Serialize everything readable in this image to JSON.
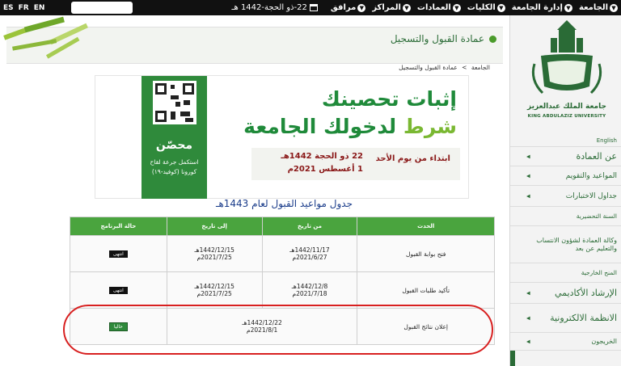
{
  "topbar": {
    "nav": [
      {
        "label": "الجامعة"
      },
      {
        "label": "إدارة الجامعة"
      },
      {
        "label": "الكليات"
      },
      {
        "label": "العمادات"
      },
      {
        "label": "المراكز"
      },
      {
        "label": "مرافق"
      }
    ],
    "date": "22-ذو الحجة-1442 هـ",
    "langs": [
      "ES",
      "FR",
      "EN"
    ]
  },
  "header": {
    "title": "عمادة القبول والتسجيل",
    "breadcrumb_home": "الجامعة",
    "breadcrumb_sep": ">",
    "breadcrumb_current": "عمادة القبول والتسجيل"
  },
  "logo": {
    "name_ar": "جامعة الملك عبدالعزيز",
    "name_en": "KING ABDULAZIZ UNIVERSITY"
  },
  "sidebar": {
    "items": [
      {
        "label": "English"
      },
      {
        "label": "عن العمادة"
      },
      {
        "label": "المواعيد والتقويم"
      },
      {
        "label": "جداول الاختبارات"
      },
      {
        "label": "السنة التحضيرية"
      },
      {
        "label": "وكالة العمادة لشؤون الانتساب والتعليم عن بعد"
      },
      {
        "label": "المنح الخارجية"
      },
      {
        "label": "الإرشاد الأكاديمي"
      },
      {
        "label": "الانظمة الالكترونية"
      },
      {
        "label": "الخريجون"
      }
    ]
  },
  "banner": {
    "line1": "إثبات تحصينك",
    "line2_w1": "شرط",
    "line2_w2": "لدخولك الجامعة",
    "start": "ابتداء من يوم الأحد",
    "date_h": "22 ذو الحجة 1442هـ",
    "date_g": "1 أغسطس 2021م",
    "qr_word": "محصّن",
    "qr_sub1": "استكمل جرعة لقاح",
    "qr_sub2": "كورونا (كوفيد-١٩)"
  },
  "table": {
    "title": "جدول مواعيد القبول لعام 1443هـ",
    "headers": [
      "الحدث",
      "من تاريخ",
      "إلى تاريخ",
      "حالة البرنامج"
    ],
    "rows": [
      {
        "event": "فتح بوابة القبول",
        "from_h": "1442/11/17هـ",
        "from_g": "2021/6/27م",
        "to_h": "1442/12/15هـ",
        "to_g": "2021/7/25م",
        "status": "انتهى"
      },
      {
        "event": "تأكيد طلبات القبول",
        "from_h": "1442/12/8هـ",
        "from_g": "2021/7/18م",
        "to_h": "1442/12/15هـ",
        "to_g": "2021/7/25م",
        "status": "انتهى"
      },
      {
        "event": "إعلان نتائج القبول",
        "from_h": "1442/12/22هـ",
        "from_g": "2021/8/1م",
        "to_h": "",
        "to_g": "",
        "status": "حاليا"
      }
    ]
  }
}
